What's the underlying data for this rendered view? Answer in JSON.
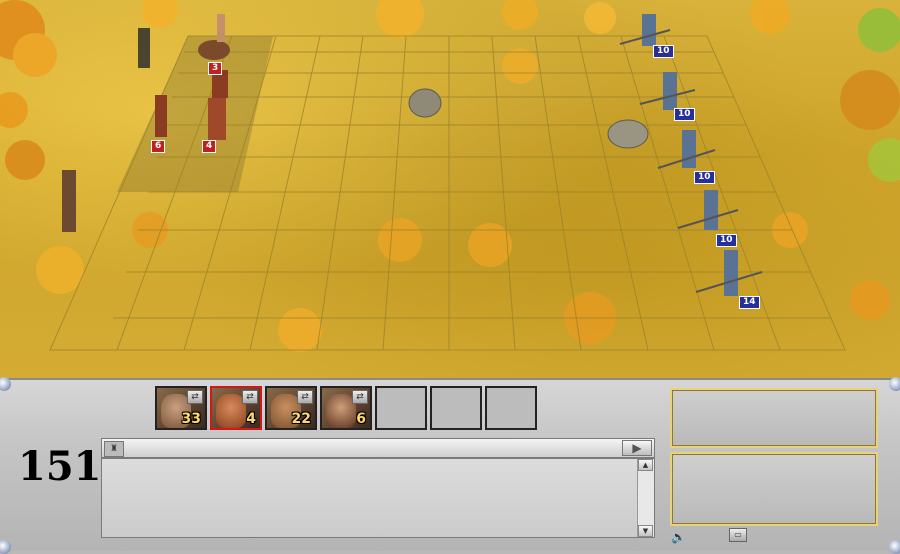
{
  "battlefield": {
    "player_units": [
      {
        "name": "centaur",
        "count": "3"
      },
      {
        "name": "minotaur",
        "count": "6"
      },
      {
        "name": "orc",
        "count": "4"
      }
    ],
    "enemy_units": [
      {
        "name": "pikeman",
        "count": "10"
      },
      {
        "name": "pikeman",
        "count": "10"
      },
      {
        "name": "pikeman",
        "count": "10"
      },
      {
        "name": "pikeman",
        "count": "10"
      },
      {
        "name": "pikeman",
        "count": "14"
      }
    ],
    "colors": {
      "player": "#c31f1f",
      "enemy": "#27309a",
      "grass": "#d4ab33",
      "grid": "#9c8428"
    }
  },
  "panel": {
    "turn_number": "151",
    "army_slots": [
      {
        "unit": "ogre",
        "count": "33",
        "selected": false,
        "icon": "split-icon"
      },
      {
        "unit": "minotaur",
        "count": "4",
        "selected": true,
        "icon": "split-icon"
      },
      {
        "unit": "orc",
        "count": "22",
        "selected": false,
        "icon": "split-icon"
      },
      {
        "unit": "amazon",
        "count": "6",
        "selected": false,
        "icon": "split-icon"
      },
      {
        "unit": "",
        "count": "",
        "selected": false
      },
      {
        "unit": "",
        "count": "",
        "selected": false
      },
      {
        "unit": "",
        "count": "",
        "selected": false
      }
    ],
    "log": {
      "text": ""
    },
    "icons": {
      "log": "army-icon",
      "next": "arrow-right-icon",
      "scroll_up": "arrow-up-icon",
      "scroll_down": "arrow-down-icon",
      "sound": "speaker-icon",
      "minimize": "window-icon"
    }
  }
}
